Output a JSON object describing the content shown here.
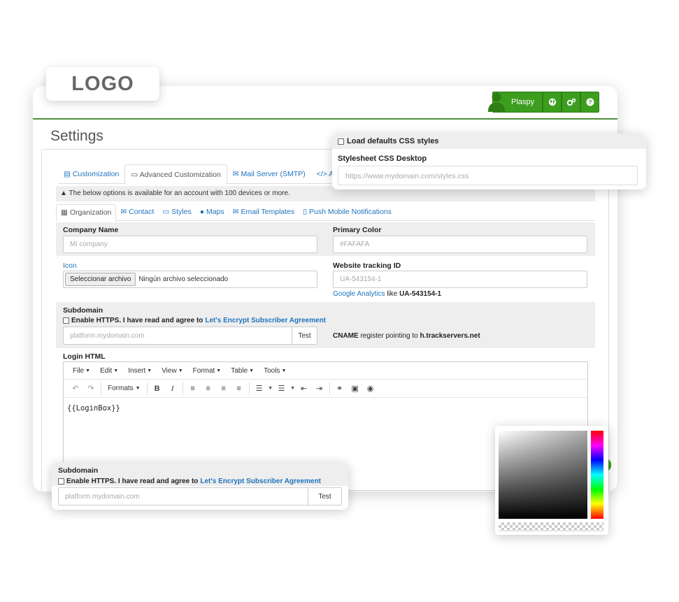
{
  "brand": {
    "logo_text": "LOGO",
    "accent": "#3c9d1e"
  },
  "header": {
    "user_name": "Plaspy",
    "icons": [
      "globe-icon",
      "cogs-icon",
      "help-icon"
    ]
  },
  "page": {
    "title": "Settings"
  },
  "tabs_main": [
    {
      "label": "Customization",
      "icon": "table-icon"
    },
    {
      "label": "Advanced Customization",
      "icon": "monitor-icon",
      "active": true
    },
    {
      "label": "Mail Server (SMTP)",
      "icon": "envelope-icon"
    },
    {
      "label": "API",
      "icon": "code-icon"
    }
  ],
  "notice": "The below options is available for an account with 100 devices or more.",
  "tabs_sub": [
    {
      "label": "Organization",
      "icon": "building-icon",
      "active": true
    },
    {
      "label": "Contact",
      "icon": "envelope-icon"
    },
    {
      "label": "Styles",
      "icon": "monitor-icon"
    },
    {
      "label": "Maps",
      "icon": "globe-icon"
    },
    {
      "label": "Email Templates",
      "icon": "envelope-icon"
    },
    {
      "label": "Push Mobile Notifications",
      "icon": "mobile-icon"
    }
  ],
  "form": {
    "company_name_label": "Company Name",
    "company_name_placeholder": "Mi company",
    "primary_color_label": "Primary Color",
    "primary_color_placeholder": "#FAFAFA",
    "icon_label": "Icon",
    "file_button": "Seleccionar archivo",
    "file_none": "Ningún archivo seleccionado",
    "tracking_label": "Website tracking ID",
    "tracking_placeholder": "UA-543154-1",
    "tracking_hint_link": "Google Analytics",
    "tracking_hint_mid": "like",
    "tracking_hint_code": "UA-543154-1",
    "subdomain_label": "Subdomain",
    "https_text": "Enable HTTPS. I have read and agree to",
    "https_link": "Let's Encrypt Subscriber Agreement",
    "subdomain_placeholder": "platform.mydomain.com",
    "test_button": "Test",
    "cname_word": "CNAME",
    "cname_mid": "register pointing to",
    "cname_host": "h.trackservers.net",
    "login_html_label": "Login HTML"
  },
  "editor": {
    "menus": [
      "File",
      "Edit",
      "Insert",
      "View",
      "Format",
      "Table",
      "Tools"
    ],
    "formats_label": "Formats",
    "content": "{{LoginBox}}"
  },
  "css_card": {
    "checkbox_label": "Load defaults CSS styles",
    "stylesheet_label": "Stylesheet CSS Desktop",
    "stylesheet_placeholder": "https://www.mydomain.com/styles.css"
  },
  "sub_card": {
    "label": "Subdomain",
    "https_text": "Enable HTTPS. I have read and agree to",
    "https_link": "Let's Encrypt Subscriber Agreement",
    "placeholder": "platform.mydomain.com",
    "test_button": "Test"
  }
}
